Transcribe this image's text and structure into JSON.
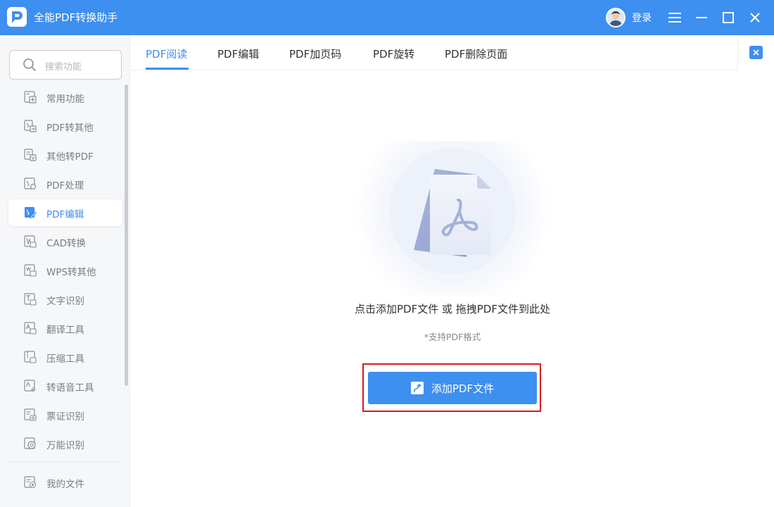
{
  "app": {
    "title": "全能PDF转换助手",
    "login_label": "登录",
    "accent": "#3d8ff0"
  },
  "search": {
    "placeholder": "搜索功能"
  },
  "sidebar": {
    "items": [
      {
        "label": "常用功能",
        "icon": "common-functions-icon"
      },
      {
        "label": "PDF转其他",
        "icon": "pdf-to-other-icon"
      },
      {
        "label": "其他转PDF",
        "icon": "other-to-pdf-icon"
      },
      {
        "label": "PDF处理",
        "icon": "pdf-process-icon"
      },
      {
        "label": "PDF编辑",
        "icon": "pdf-edit-icon",
        "active": true
      },
      {
        "label": "CAD转换",
        "icon": "cad-icon"
      },
      {
        "label": "WPS转其他",
        "icon": "wps-icon"
      },
      {
        "label": "文字识别",
        "icon": "ocr-icon"
      },
      {
        "label": "翻译工具",
        "icon": "translate-icon"
      },
      {
        "label": "压缩工具",
        "icon": "zip-icon"
      },
      {
        "label": "转语音工具",
        "icon": "speech-icon"
      },
      {
        "label": "票证识别",
        "icon": "ticket-icon"
      },
      {
        "label": "万能识别",
        "icon": "universal-recognition-icon"
      }
    ],
    "my_files": "我的文件"
  },
  "tabs": [
    {
      "label": "PDF阅读",
      "active": true
    },
    {
      "label": "PDF编辑"
    },
    {
      "label": "PDF加页码"
    },
    {
      "label": "PDF旋转"
    },
    {
      "label": "PDF删除页面"
    }
  ],
  "main": {
    "drop_text": "点击添加PDF文件 或 拖拽PDF文件到此处",
    "sub_text": "*支持PDF格式",
    "add_button_label": "添加PDF文件"
  }
}
